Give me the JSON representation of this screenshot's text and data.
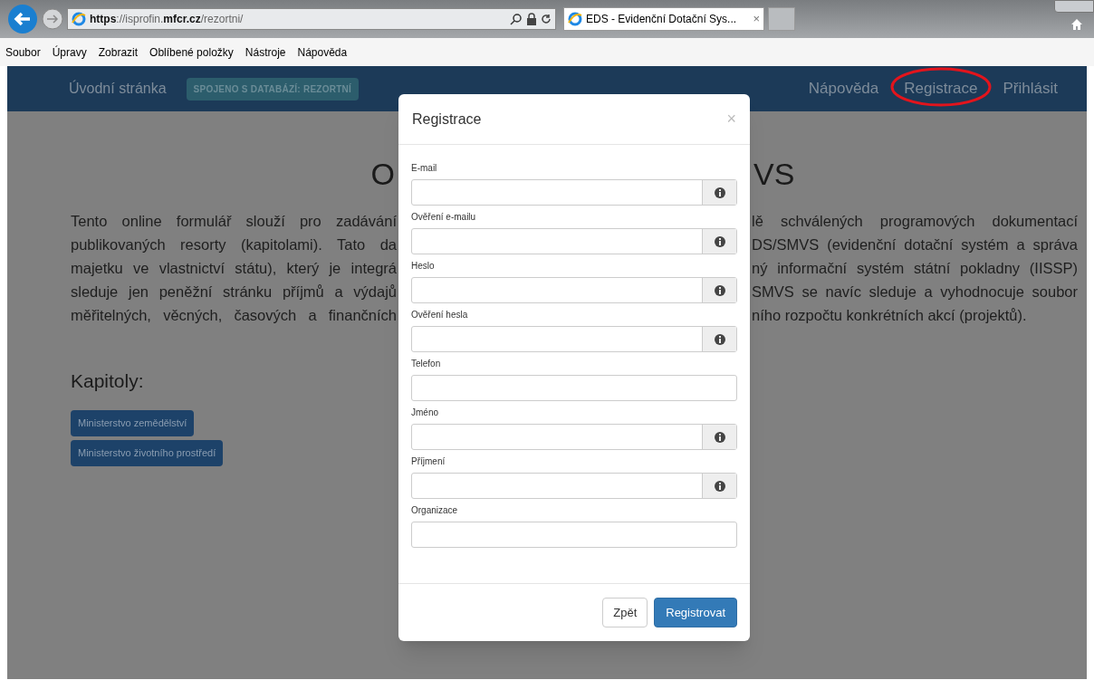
{
  "browser": {
    "url": "**https**://isprofin.**mfcr.cz**/rezortni/",
    "tab": {
      "title": "EDS - Evidenční Dotační Sys...",
      "close": "×"
    }
  },
  "menu_bar": [
    "Soubor",
    "Úpravy",
    "Zobrazit",
    "Oblíbené položky",
    "Nástroje",
    "Nápověda"
  ],
  "navbar": {
    "home": "Úvodní stránka",
    "badge": "SPOJENO S DATABÁZÍ: REZORTNÍ",
    "links": [
      {
        "label": "Nápověda",
        "circled": false
      },
      {
        "label": "Registrace",
        "circled": true
      },
      {
        "label": "Přihlásit",
        "circled": false
      }
    ]
  },
  "page": {
    "heading_left": "O",
    "heading_right": "VS",
    "paragraph_lines": [
      {
        "left": "Tento online formulář slouží pro zadávání",
        "right": "lě schválených programových dokumentací"
      },
      {
        "left": "publikovaných resorty (kapitolami). Tato da",
        "right": "DS/SMVS (evidenční dotační systém a správa"
      },
      {
        "left": "majetku ve vlastnictví státu), který je integrá",
        "right": "ný informační systém státní pokladny (IISSP)"
      },
      {
        "left": "sleduje jen peněžní stránku příjmů a výdajů",
        "right": "SMVS se navíc sleduje a vyhodnocuje soubor"
      },
      {
        "left": "měřitelných, věcných, časových a finančních",
        "right": "ního rozpočtu konkrétních akcí (projektů)."
      }
    ],
    "chapters_title": "Kapitoly:",
    "chapters": [
      "Ministerstvo zemědělství",
      "Ministerstvo životního prostředí"
    ]
  },
  "modal": {
    "title": "Registrace",
    "close": "×",
    "fields": [
      {
        "label": "E-mail",
        "info": true
      },
      {
        "label": "Ověření e-mailu",
        "info": true
      },
      {
        "label": "Heslo",
        "info": true
      },
      {
        "label": "Ověření hesla",
        "info": true
      },
      {
        "label": "Telefon",
        "info": false
      },
      {
        "label": "Jméno",
        "info": true
      },
      {
        "label": "Příjmení",
        "info": true
      },
      {
        "label": "Organizace",
        "info": false
      }
    ],
    "buttons": [
      {
        "label": "Zpět",
        "kind": "default"
      },
      {
        "label": "Registrovat",
        "kind": "primary"
      }
    ]
  }
}
